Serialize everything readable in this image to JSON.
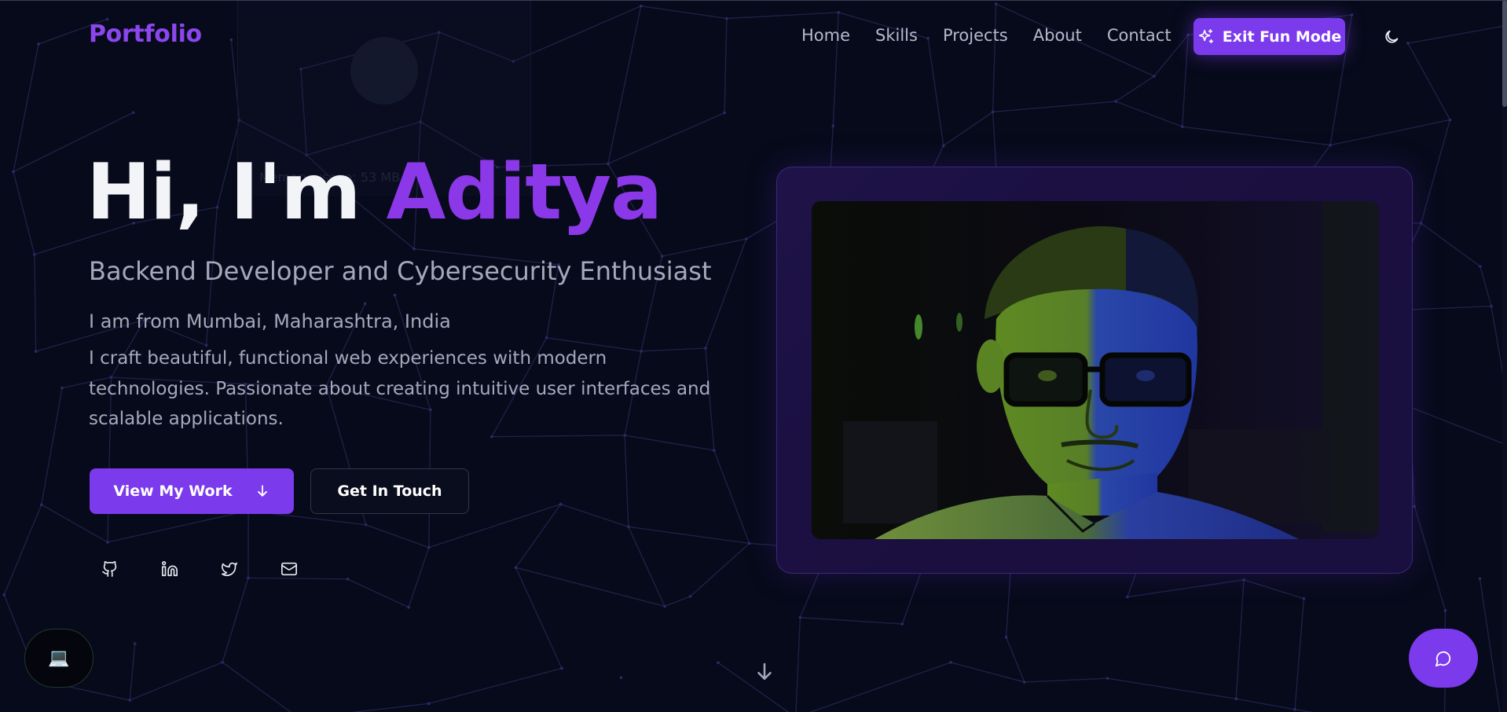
{
  "brand": "Portfolio",
  "nav": {
    "links": [
      "Home",
      "Skills",
      "Projects",
      "About",
      "Contact"
    ],
    "fun_button_label": "Exit Fun Mode",
    "fun_button_icon": "sparkles-icon",
    "theme_icon": "moon-icon"
  },
  "hero": {
    "greeting": "Hi, I'm",
    "name": "Aditya",
    "subtitle": "Backend Developer and Cybersecurity Enthusiast",
    "location": "I am from Mumbai, Maharashtra, India",
    "bio": "I craft beautiful, functional web experiences with modern technologies. Passionate about creating intuitive user interfaces and scalable applications.",
    "primary_button": "View My Work",
    "secondary_button": "Get In Touch"
  },
  "background_overlay_text": "Memory usage: 53 MB",
  "social_icons": [
    "github-icon",
    "linkedin-icon",
    "twitter-icon",
    "mail-icon"
  ],
  "floating": {
    "left_icon": "laptop-icon",
    "left_glyph": "💻",
    "chat_icon": "chat-icon"
  },
  "colors": {
    "background": "#070a1a",
    "accent": "#7c3aed",
    "name_accent": "#8b38e8",
    "muted_text": "#a3a9bd",
    "nav_text": "#b5b9cb"
  }
}
